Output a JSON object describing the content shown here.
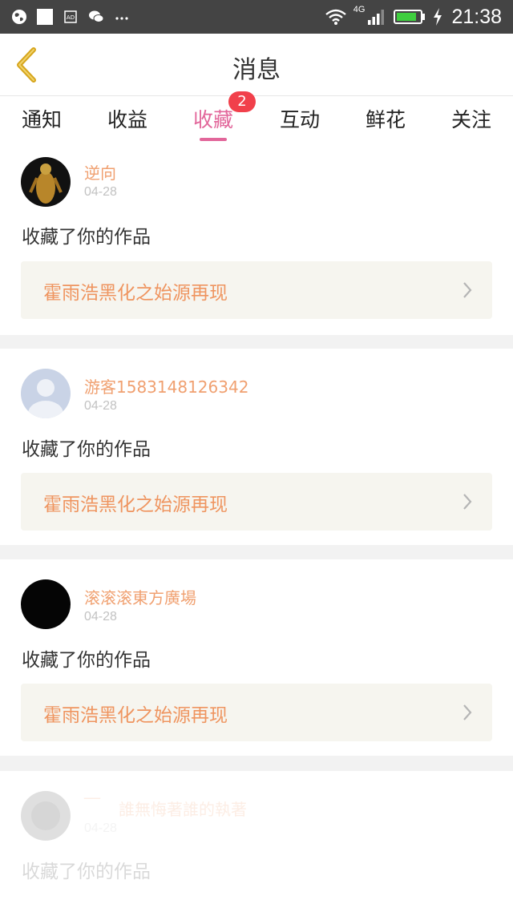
{
  "status_bar": {
    "time": "21:38",
    "network_label": "4G",
    "colors": {
      "background": "#444444",
      "battery": "#3fcf3f"
    }
  },
  "header": {
    "title": "消息",
    "back_icon": "chevron-left-icon",
    "back_color": "#d6a51c"
  },
  "tabs": {
    "items": [
      {
        "label": "通知"
      },
      {
        "label": "收益"
      },
      {
        "label": "收藏",
        "badge": "2",
        "active": true
      },
      {
        "label": "互动"
      },
      {
        "label": "鲜花"
      },
      {
        "label": "关注"
      }
    ],
    "active_color": "#e2669a"
  },
  "messages": [
    {
      "username": "逆向",
      "date": "04-28",
      "action": "收藏了你的作品",
      "work_title": "霍雨浩黑化之始源再现"
    },
    {
      "username": "游客1583148126342",
      "date": "04-28",
      "action": "收藏了你的作品",
      "work_title": "霍雨浩黑化之始源再现"
    },
    {
      "username": "滚滚滚東方廣場",
      "date": "04-28",
      "action": "收藏了你的作品",
      "work_title": "霍雨浩黑化之始源再现"
    },
    {
      "username": "誰無悔著誰的執著",
      "username_prefix": "‾‾",
      "date": "04-28",
      "action": "收藏了你的作品"
    }
  ]
}
